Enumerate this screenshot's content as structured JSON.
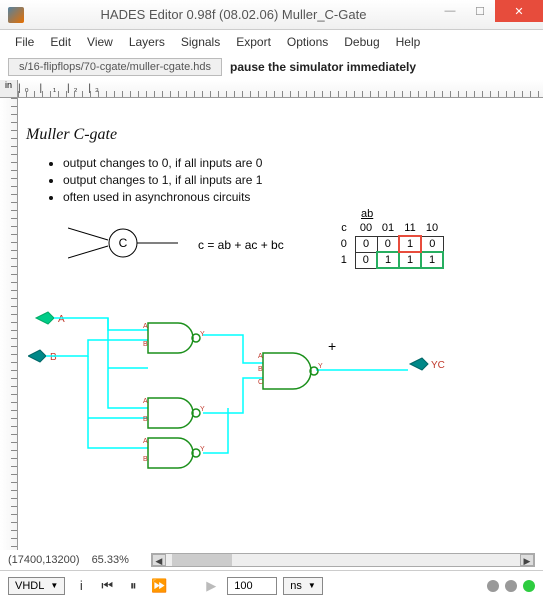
{
  "window": {
    "title": "HADES Editor 0.98f (08.02.06)   Muller_C-Gate"
  },
  "menu": {
    "items": [
      "File",
      "Edit",
      "View",
      "Layers",
      "Signals",
      "Export",
      "Options",
      "Debug",
      "Help"
    ]
  },
  "toolbar": {
    "file_path": "s/16-flipflops/70-cgate/muller-cgate.hds",
    "status_msg": "pause the simulator immediately"
  },
  "ruler": {
    "unit": "in"
  },
  "schematic": {
    "title": "Muller C-gate",
    "bullets": [
      "output changes to 0, if all inputs are 0",
      "output changes to 1, if all inputs are 1",
      "often used in asynchronous circuits"
    ],
    "symbol_label": "C",
    "formula": "c = ab + ac + bc",
    "kmap": {
      "row_var": "c",
      "col_var": "ab",
      "col_headers": [
        "00",
        "01",
        "11",
        "10"
      ],
      "rows": [
        {
          "label": "0",
          "cells": [
            "0",
            "0",
            "1",
            "0"
          ]
        },
        {
          "label": "1",
          "cells": [
            "0",
            "1",
            "1",
            "1"
          ]
        }
      ]
    },
    "ports": {
      "in_a": "A",
      "in_b": "B",
      "out": "YC"
    }
  },
  "status": {
    "coords": "(17400,13200)",
    "zoom": "65.33%"
  },
  "sim": {
    "lang": "VHDL",
    "time_value": "100",
    "time_unit": "ns"
  }
}
